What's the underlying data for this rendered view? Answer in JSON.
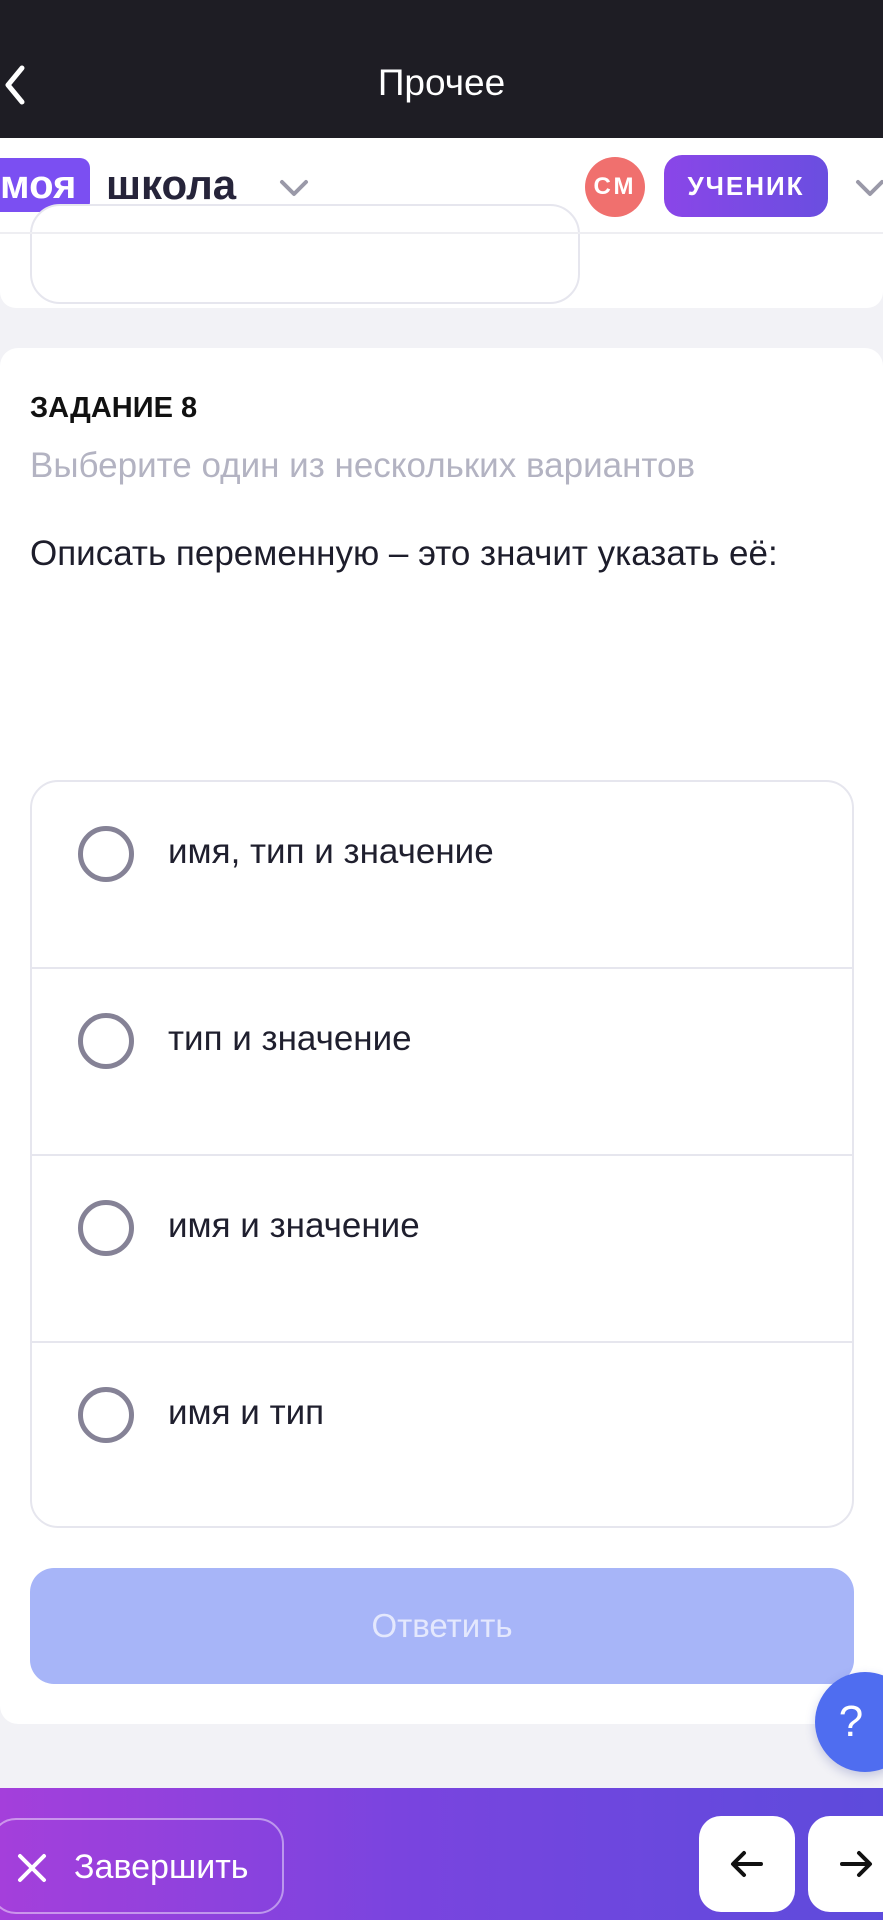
{
  "topbar": {
    "title": "Прочее"
  },
  "school_header": {
    "logo_badge": "моя",
    "logo_text": "школа",
    "avatar_initials": "СМ",
    "role": "УЧЕНИК"
  },
  "task": {
    "label": "ЗАДАНИЕ 8",
    "hint": "Выберите один из нескольких вариантов",
    "question": "Описать переменную – это значит указать её:",
    "options": [
      {
        "label": "имя, тип и значение"
      },
      {
        "label": "тип и значение"
      },
      {
        "label": "имя и значение"
      },
      {
        "label": "имя и тип"
      }
    ],
    "submit_label": "Ответить"
  },
  "help_fab": {
    "label": "?"
  },
  "bottombar": {
    "finish_label": "Завершить"
  },
  "colors": {
    "accent": "#7b4ff2",
    "avatar": "#f0706e",
    "submit_disabled": "#a7b5f8",
    "help": "#4f6df0"
  }
}
